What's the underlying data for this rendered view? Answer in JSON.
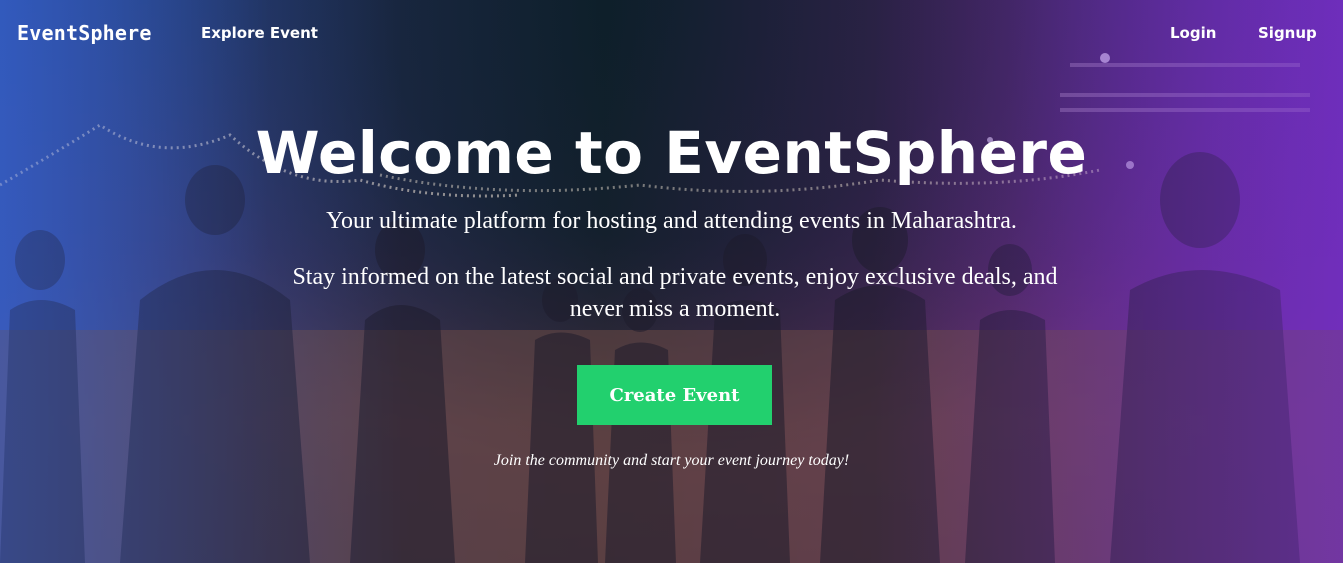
{
  "nav": {
    "brand": "EventSphere",
    "explore": "Explore Event",
    "login": "Login",
    "signup": "Signup"
  },
  "hero": {
    "title": "Welcome to EventSphere",
    "tagline": "Your ultimate platform for hosting and attending events in Maharashtra.",
    "description": "Stay informed on the latest social and private events, enjoy exclusive deals, and never miss a moment.",
    "cta_label": "Create Event",
    "footnote": "Join the community and start your event journey today!"
  },
  "colors": {
    "cta": "#22d06e",
    "gradient_left": "#2e5cc8",
    "gradient_right": "#6e28be"
  },
  "background": {
    "image_subject": "crowd-at-night-beach-festival"
  }
}
